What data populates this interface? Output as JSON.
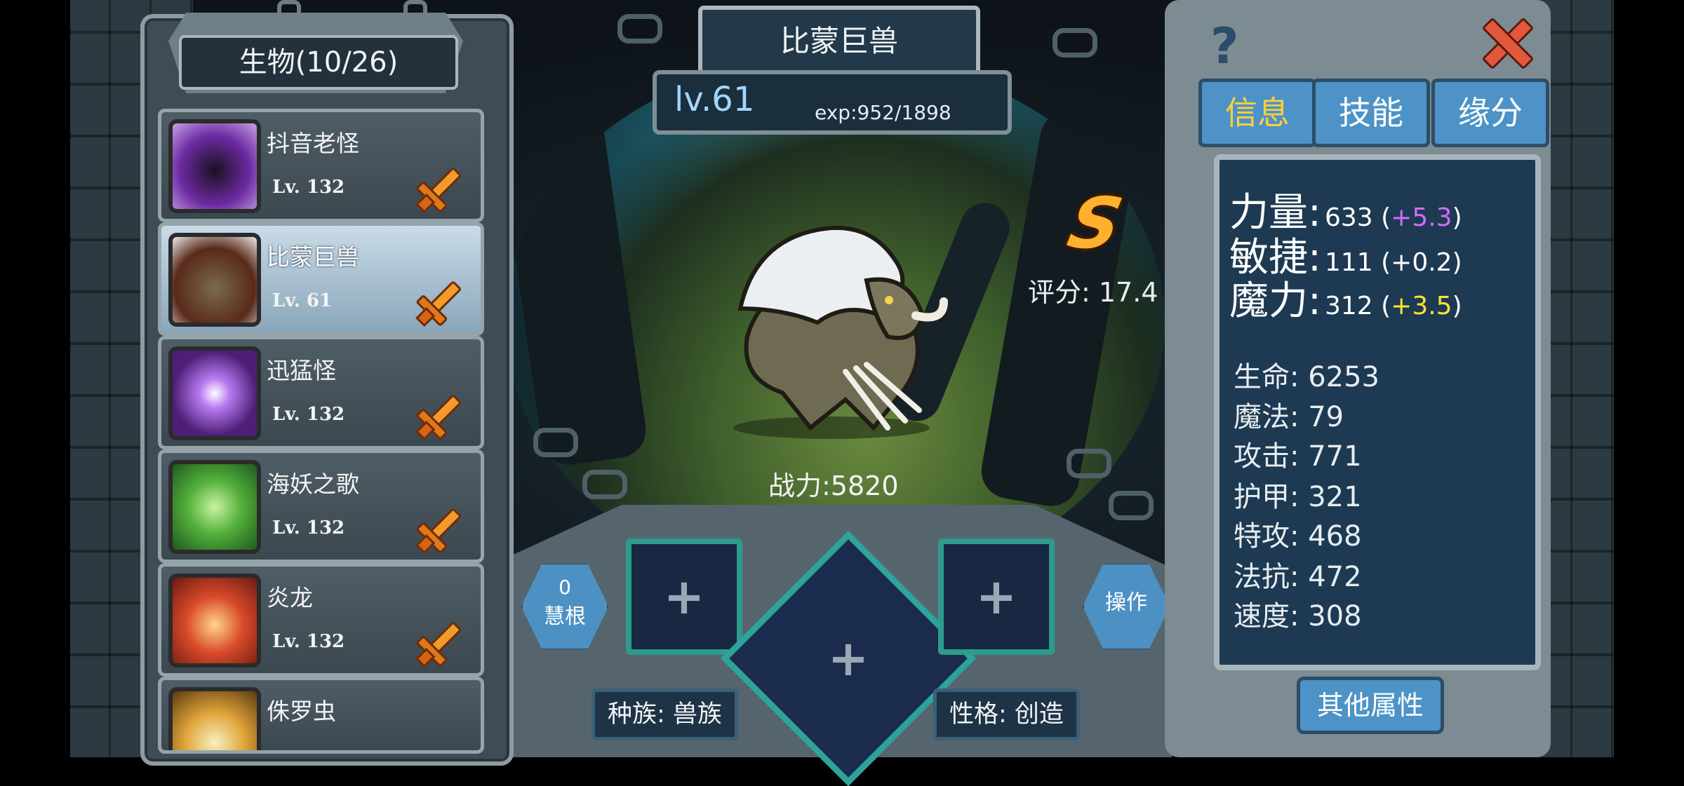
{
  "creature_list": {
    "title": "生物(10/26)",
    "items": [
      {
        "name": "抖音老怪",
        "level": "Lv. 132",
        "selected": false
      },
      {
        "name": "比蒙巨兽",
        "level": "Lv. 61",
        "selected": true
      },
      {
        "name": "迅猛怪",
        "level": "Lv. 132",
        "selected": false
      },
      {
        "name": "海妖之歌",
        "level": "Lv. 132",
        "selected": false
      },
      {
        "name": "炎龙",
        "level": "Lv. 132",
        "selected": false
      },
      {
        "name": "侏罗虫",
        "level": "",
        "selected": false
      }
    ]
  },
  "detail": {
    "name": "比蒙巨兽",
    "level": "lv.61",
    "exp": "exp:952/1898",
    "grade": "S",
    "score": "评分: 17.4",
    "power": "战力:5820",
    "wisdom_count": "0",
    "wisdom_label": "慧根",
    "operate_label": "操作",
    "race": "种族: 兽族",
    "personality": "性格: 创造",
    "slot_plus": "+"
  },
  "tabs": [
    {
      "label": "信息",
      "active": true
    },
    {
      "label": "技能",
      "active": false
    },
    {
      "label": "缘分",
      "active": false
    }
  ],
  "icons": {
    "help": "?",
    "close": "close-icon"
  },
  "main_stats": [
    {
      "label": "力量:",
      "value": "633 (",
      "bonus": "+5.3",
      "close": ")",
      "bonus_color": "#d46bff"
    },
    {
      "label": "敏捷:",
      "value": "111 (",
      "bonus": "+0.2",
      "close": ")",
      "bonus_color": "#ffffff"
    },
    {
      "label": "魔力:",
      "value": "312 (",
      "bonus": "+3.5",
      "close": ")",
      "bonus_color": "#ffe23a"
    }
  ],
  "sub_stats": [
    {
      "label": "生命:",
      "value": "6253"
    },
    {
      "label": "魔法:",
      "value": "79"
    },
    {
      "label": "攻击:",
      "value": "771"
    },
    {
      "label": "护甲:",
      "value": "321"
    },
    {
      "label": "特攻:",
      "value": "468"
    },
    {
      "label": "法抗:",
      "value": "472"
    },
    {
      "label": "速度:",
      "value": "308"
    }
  ],
  "other_button": "其他属性"
}
